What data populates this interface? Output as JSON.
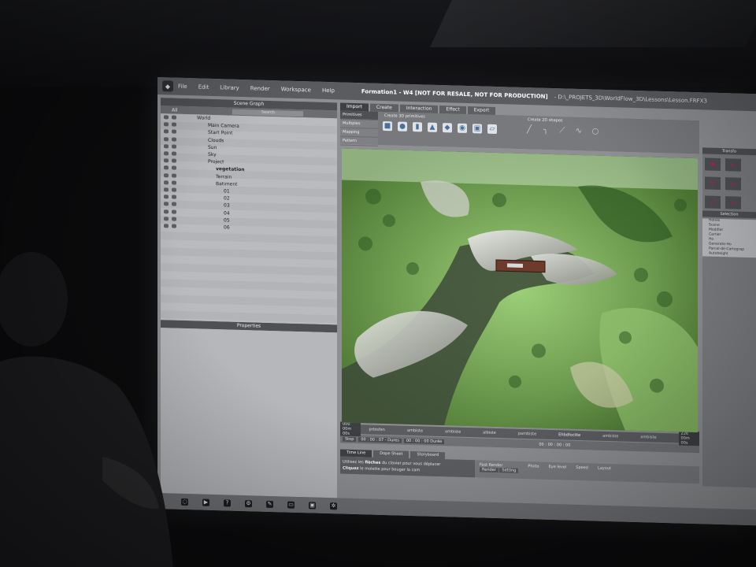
{
  "menu": {
    "items": [
      "File",
      "Edit",
      "Library",
      "Render",
      "Workspace",
      "Help"
    ],
    "window_title": "Formation1 - W4 [NOT FOR RESALE, NOT FOR PRODUCTION]",
    "window_path": "- D:\\_PROJETS_3D\\WorldFlow_3D\\Lessons\\Lesson.FRFX3"
  },
  "scene_graph": {
    "header": "Scene Graph",
    "filter_all": "All",
    "search_placeholder": "Search",
    "items": [
      "World",
      "Main Camera",
      "Start Point",
      "Clouds",
      "Sun",
      "Sky",
      "Project",
      "vegetation",
      "Terrain",
      "Batiment",
      "01",
      "02",
      "03",
      "04",
      "05",
      "06"
    ]
  },
  "properties": {
    "header": "Properties"
  },
  "tabs": [
    "Import",
    "Create",
    "Interaction",
    "Effect",
    "Export"
  ],
  "ribbon": {
    "side": [
      "Primitives",
      "Multiples",
      "Mapping",
      "Pattern"
    ],
    "create_3d_label": "Create 3D primitives",
    "create_2d_label": "Create 2D shapes"
  },
  "timeline": {
    "start": "000 00m 00s",
    "ticks": [
      "prbisfen",
      "ambiste",
      "ambiste",
      "albiste",
      "pambiste",
      "Ehbdfoclite",
      "ambiste",
      "ambiste"
    ],
    "end": "226 00m 00s",
    "transport": [
      "Stop",
      "00 : 00 : 07 - Dures",
      "00 : 00 : 00 Durée"
    ],
    "time_readout": "00 : 00 : 00 : 00"
  },
  "bottom": {
    "tabs": [
      "Time Line",
      "Dope Sheet",
      "Storyboard"
    ],
    "hint1_prefix": "Utilisez les",
    "hint1_key": "flèches",
    "hint1_suffix": "du clavier pour vous déplacer",
    "hint2_prefix": "Cliquez",
    "hint2_mid": "le molette",
    "hint2_suffix": "pour bouger la cam",
    "fast_render": "Fast Render",
    "render_btn": "Render",
    "setting_btn": "Setting",
    "photo": "Photo",
    "eye_level": "Eye level",
    "speed": "Speed",
    "layout": "Layout"
  },
  "right": {
    "transform_header": "Transfo",
    "selection_header": "Selection",
    "list": [
      "Hotels",
      "Scene",
      "Modifier",
      "Carrier",
      "Ho",
      "Generate-Ho",
      "Parcel-de-Cartograp",
      "Autoheight"
    ],
    "accent": "#e8232b"
  },
  "taskbar": {
    "icons": [
      "start",
      "media",
      "help",
      "settings",
      "tools",
      "monitor",
      "render",
      "settings2"
    ]
  }
}
